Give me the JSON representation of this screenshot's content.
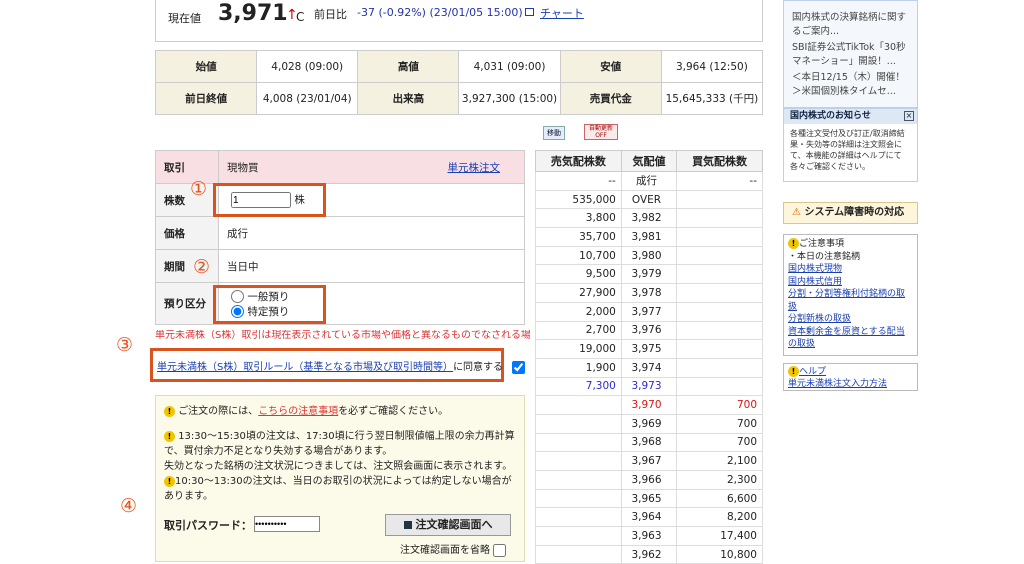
{
  "price": {
    "label": "現在値",
    "value": "3,971",
    "arrow": "↑",
    "c": "C",
    "change_label": "前日比",
    "change": "-37 (-0.92%) (23/01/05 15:00)",
    "chart": "チャート"
  },
  "quote": {
    "open_label": "始値",
    "open": "4,028 (09:00)",
    "high_label": "高値",
    "high": "4,031 (09:00)",
    "low_label": "安値",
    "low": "3,964 (12:50)",
    "prev_label": "前日終値",
    "prev": "4,008 (23/01/04)",
    "vol_label": "出来高",
    "vol": "3,927,300 (15:00)",
    "amt_label": "売買代金",
    "amt": "15,645,333 (千円)"
  },
  "ctl": {
    "move": "移動",
    "refresh": "自動更新 OFF"
  },
  "order": {
    "trade_label": "取引",
    "trade": "現物買",
    "unit_link": "単元株注文",
    "qty_label": "株数",
    "qty": "1",
    "qty_unit": "株",
    "price_label": "価格",
    "price": "成行",
    "period_label": "期間",
    "period": "当日中",
    "dep_label": "預り区分",
    "dep_general": "一般預り",
    "dep_specific": "特定預り"
  },
  "warn": "単元未満株（S株）取引は現在表示されている市場や価格と異なるものでなされる場合がございます。",
  "agree": {
    "link": "単元未満株（S株）取引ルール（基準となる市場及び取引時間等）",
    "text": "に同意する"
  },
  "notes": {
    "n1a": "ご注文の際には、",
    "n1link": "こちらの注意事項",
    "n1b": "を必ずご確認ください。",
    "n2": "13:30〜15:30頃の注文は、17:30頃に行う翌日制限値幅上限の余力再計算で、買付余力不足となり失効する場合があります。",
    "n3": "失効となった銘柄の注文状況につきましては、注文照会画面に表示されます。",
    "n4": "10:30〜13:30の注文は、当日のお取引の状況によっては約定しない場合があります。",
    "pw_label": "取引パスワード：",
    "pw": "••••••••••",
    "confirm": "注文確認画面へ",
    "skip": "注文確認画面を省略"
  },
  "marks": {
    "m1": "①",
    "m2": "②",
    "m3": "③",
    "m4": "④"
  },
  "board": {
    "h_sell": "売気配株数",
    "h_price": "気配値",
    "h_buy": "買気配株数",
    "rows": [
      [
        "--",
        "成行",
        "--"
      ],
      [
        "535,000",
        "OVER",
        ""
      ],
      [
        "3,800",
        "3,982",
        ""
      ],
      [
        "35,700",
        "3,981",
        ""
      ],
      [
        "10,700",
        "3,980",
        ""
      ],
      [
        "9,500",
        "3,979",
        ""
      ],
      [
        "27,900",
        "3,978",
        ""
      ],
      [
        "2,000",
        "3,977",
        ""
      ],
      [
        "2,700",
        "3,976",
        ""
      ],
      [
        "19,000",
        "3,975",
        ""
      ],
      [
        "1,900",
        "3,974",
        ""
      ],
      [
        "7,300",
        "3,973",
        ""
      ],
      [
        "",
        "3,970",
        "700"
      ],
      [
        "",
        "3,969",
        "700"
      ],
      [
        "",
        "3,968",
        "700"
      ],
      [
        "",
        "3,967",
        "2,100"
      ],
      [
        "",
        "3,966",
        "2,300"
      ],
      [
        "",
        "3,965",
        "6,600"
      ],
      [
        "",
        "3,964",
        "8,200"
      ],
      [
        "",
        "3,963",
        "17,400"
      ],
      [
        "",
        "3,962",
        "10,800"
      ]
    ]
  },
  "side": {
    "news": [
      "国内株式の決算銘柄に関するご案内...",
      "SBI証券公式TikTok「30秒マネーショー」開設！...",
      "＜本日12/15（木）開催！＞米国個別株タイムセ..."
    ],
    "notice_title": "国内株式のお知らせ",
    "notice": "各種注文受付及び訂正/取消締結果・失効等の詳細は注文照会にて、本機能の詳細はヘルプにて各々ご確認ください。",
    "system": "システム障害時の対応",
    "caution_title": "ご注意事項",
    "caution_sub": "・本日の注意銘柄",
    "links": [
      "国内株式現物",
      "国内株式信用",
      "分割・分割等権利付銘柄の取扱",
      "分割新株の取扱",
      "資本剰余金を原資とする配当の取扱"
    ],
    "help": "ヘルプ",
    "help_link": "単元未満株注文入力方法"
  }
}
